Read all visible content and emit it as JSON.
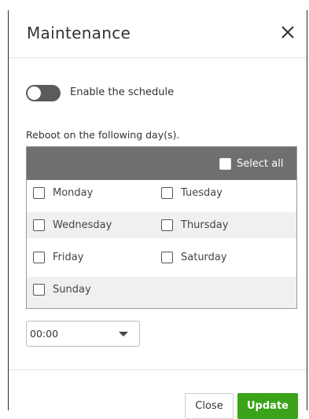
{
  "dialog": {
    "title": "Maintenance"
  },
  "schedule": {
    "enabled": false,
    "toggle_label": "Enable the schedule"
  },
  "reboot": {
    "label": "Reboot on the following day(s).",
    "select_all_label": "Select all",
    "days": [
      {
        "label": "Monday",
        "checked": false
      },
      {
        "label": "Tuesday",
        "checked": false
      },
      {
        "label": "Wednesday",
        "checked": false
      },
      {
        "label": "Thursday",
        "checked": false
      },
      {
        "label": "Friday",
        "checked": false
      },
      {
        "label": "Saturday",
        "checked": false
      },
      {
        "label": "Sunday",
        "checked": false
      }
    ]
  },
  "time": {
    "value": "00:00"
  },
  "footer": {
    "close_label": "Close",
    "update_label": "Update"
  },
  "colors": {
    "accent": "#3aa319",
    "table_header": "#6f6f6f",
    "toggle_off": "#5b5b5b"
  }
}
